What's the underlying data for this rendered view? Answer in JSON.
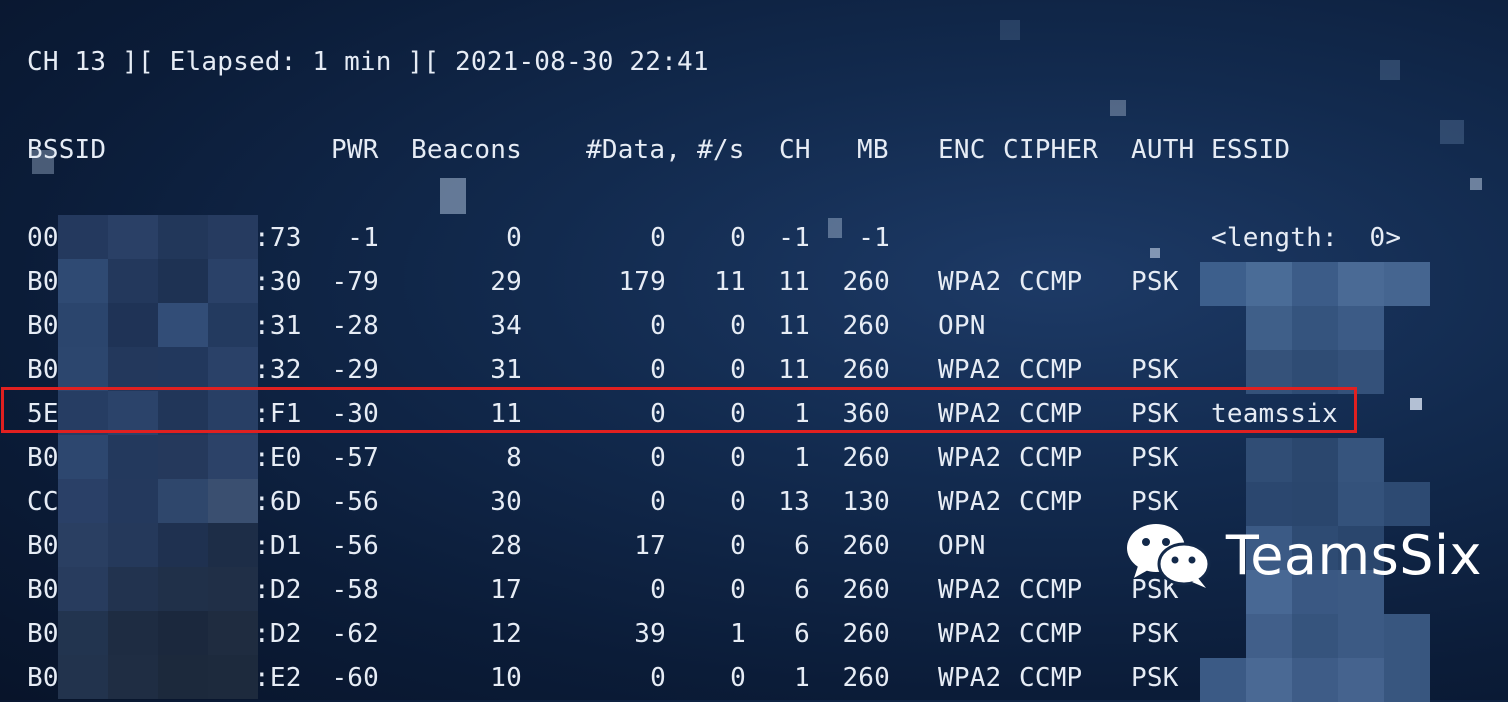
{
  "header": {
    "status_line": "CH 13 ][ Elapsed: 1 min ][ 2021-08-30 22:41"
  },
  "table": {
    "columns": {
      "bssid": "BSSID",
      "pwr": "PWR",
      "beacons": "Beacons",
      "data": "#Data,",
      "per_s": "#/s",
      "ch": "CH",
      "mb": "MB",
      "enc": "ENC",
      "cipher": "CIPHER",
      "auth": "AUTH",
      "essid": "ESSID"
    },
    "rows": [
      {
        "bssid_prefix": "00",
        "bssid_suffix": ":73",
        "pwr": "-1",
        "beacons": "0",
        "data": "0",
        "per_s": "0",
        "ch": "-1",
        "mb": "-1",
        "enc": "",
        "cipher": "",
        "auth": "",
        "essid": "<length:  0>"
      },
      {
        "bssid_prefix": "B0",
        "bssid_suffix": ":30",
        "pwr": "-79",
        "beacons": "29",
        "data": "179",
        "per_s": "11",
        "ch": "11",
        "mb": "260",
        "enc": "WPA2",
        "cipher": "CCMP",
        "auth": "PSK",
        "essid": ""
      },
      {
        "bssid_prefix": "B0",
        "bssid_suffix": ":31",
        "pwr": "-28",
        "beacons": "34",
        "data": "0",
        "per_s": "0",
        "ch": "11",
        "mb": "260",
        "enc": "OPN",
        "cipher": "",
        "auth": "",
        "essid": ""
      },
      {
        "bssid_prefix": "B0",
        "bssid_suffix": ":32",
        "pwr": "-29",
        "beacons": "31",
        "data": "0",
        "per_s": "0",
        "ch": "11",
        "mb": "260",
        "enc": "WPA2",
        "cipher": "CCMP",
        "auth": "PSK",
        "essid": ""
      },
      {
        "bssid_prefix": "5E",
        "bssid_suffix": ":F1",
        "pwr": "-30",
        "beacons": "11",
        "data": "0",
        "per_s": "0",
        "ch": "1",
        "mb": "360",
        "enc": "WPA2",
        "cipher": "CCMP",
        "auth": "PSK",
        "essid": "teamssix"
      },
      {
        "bssid_prefix": "B0",
        "bssid_suffix": ":E0",
        "pwr": "-57",
        "beacons": "8",
        "data": "0",
        "per_s": "0",
        "ch": "1",
        "mb": "260",
        "enc": "WPA2",
        "cipher": "CCMP",
        "auth": "PSK",
        "essid": ""
      },
      {
        "bssid_prefix": "CC",
        "bssid_suffix": ":6D",
        "pwr": "-56",
        "beacons": "30",
        "data": "0",
        "per_s": "0",
        "ch": "13",
        "mb": "130",
        "enc": "WPA2",
        "cipher": "CCMP",
        "auth": "PSK",
        "essid": ""
      },
      {
        "bssid_prefix": "B0",
        "bssid_suffix": ":D1",
        "pwr": "-56",
        "beacons": "28",
        "data": "17",
        "per_s": "0",
        "ch": "6",
        "mb": "260",
        "enc": "OPN",
        "cipher": "",
        "auth": "",
        "essid": ""
      },
      {
        "bssid_prefix": "B0",
        "bssid_suffix": ":D2",
        "pwr": "-58",
        "beacons": "17",
        "data": "0",
        "per_s": "0",
        "ch": "6",
        "mb": "260",
        "enc": "WPA2",
        "cipher": "CCMP",
        "auth": "PSK",
        "essid": ""
      },
      {
        "bssid_prefix": "B0",
        "bssid_suffix": ":D2",
        "pwr": "-62",
        "beacons": "12",
        "data": "39",
        "per_s": "1",
        "ch": "6",
        "mb": "260",
        "enc": "WPA2",
        "cipher": "CCMP",
        "auth": "PSK",
        "essid": ""
      },
      {
        "bssid_prefix": "B0",
        "bssid_suffix": ":E2",
        "pwr": "-60",
        "beacons": "10",
        "data": "0",
        "per_s": "0",
        "ch": "1",
        "mb": "260",
        "enc": "WPA2",
        "cipher": "CCMP",
        "auth": "PSK",
        "essid": ""
      }
    ],
    "highlighted_row_index": 4
  },
  "watermark": {
    "text": "TeamsSix",
    "icon": "wechat-icon"
  },
  "colors": {
    "highlight_border": "#e02020",
    "text": "#e6ecf5"
  }
}
